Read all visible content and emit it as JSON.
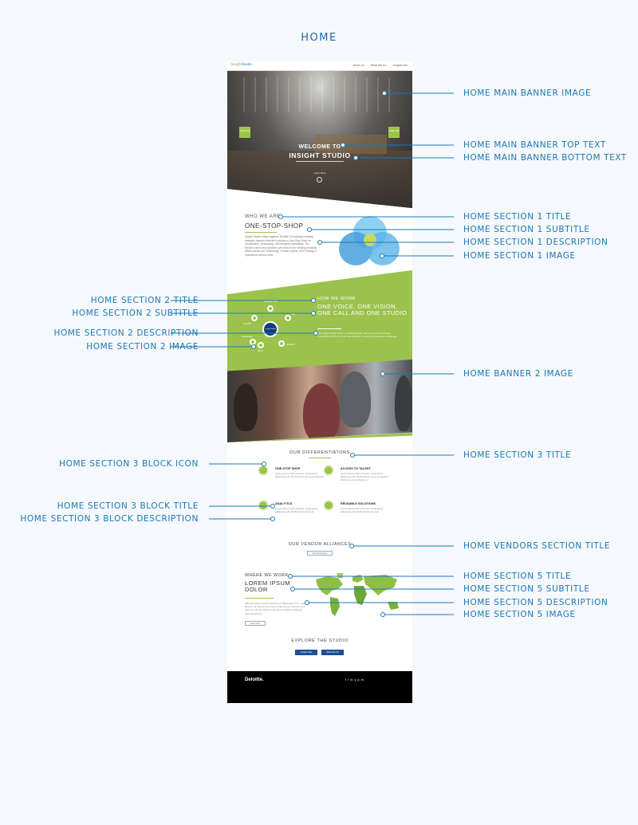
{
  "page_heading": "HOME",
  "nav": {
    "logo_a": "Insight",
    "logo_b": "Studio",
    "links": [
      "About Us",
      "What We Do",
      "Insights Bar"
    ]
  },
  "banner": {
    "tag_left": "Insights Bar",
    "tag_right": "Insights Bar",
    "top_text": "WELCOME TO",
    "bottom_text": "INSIGHT STUDIO",
    "learn": "Learn More"
  },
  "section1": {
    "title": "WHO WE ARE",
    "subtitle": "ONE-STOP-SHOP",
    "description": "Insight Studio brings together Deloitte Consulting's leading analytics domain experts to provide a One-Stop-Shop for visualization, prototyping, and analytics specialists. The Studio's talent and solutions are drawn from existing Analytics efforts across our Technology, Human Capital, and Strategy & Operations service lines."
  },
  "section2": {
    "title": "HOW WE WORK",
    "subtitle": "ONE VOICE, ONE VISION, ONE CALL AND ONE STUDIO",
    "description": "The Insight Studio forms a multidisciplinary team from across Deloitte Consulting with deep and broad expertise to tackle any analytics challenge.",
    "hub": "Insight Studio",
    "nodes": [
      "Business Need",
      "Analytics",
      "Data",
      "Visualization",
      "Talent",
      "Solutions"
    ]
  },
  "section3": {
    "title": "OUR DIFFERENTIATORS",
    "blocks": [
      {
        "title": "ONE-STOP SHOP",
        "desc": "Lorem ipsum dolor sit amet, consectetur adipiscing elit. Morbi lacinia nisi sed maximus."
      },
      {
        "title": "ACCESS TO TALENT",
        "desc": "Lorem ipsum dolor sit amet, consectetur adipiscing elit. Morbi lacinia nisi sed maximus tincidunt, est ut aliquet est."
      },
      {
        "title": "ANALYTICS",
        "desc": "Lorem ipsum dolor sit amet, consectetur adipiscing elit. Morbi lacinia nisi sed."
      },
      {
        "title": "REUSABLE SOLUTIONS",
        "desc": "Lorem ipsum dolor sit amet, consectetur adipiscing elit. Morbi lacinia nisi sed."
      }
    ]
  },
  "vendors": {
    "title": "OUR VENDOR ALLIANCES",
    "button": "View All Vendors"
  },
  "section5": {
    "title": "WHERE WE WORK",
    "subtitle": "LOREM IPSUM DOLOR",
    "description": "With permanent studio locations in Washington D.C. and Boston, as well as Lime Teams that can go wherever you need us, we can deliver data-driven insights anywhere and everywhere.",
    "button": "Learn More"
  },
  "explore": {
    "title": "EXPLORE THE STUDIO",
    "buttons": [
      "Insights Bar",
      "What We Do"
    ]
  },
  "footer": {
    "logo": "Deloitte.",
    "social": [
      "t",
      "f",
      "in",
      "y",
      "p",
      "m"
    ]
  },
  "annotations": {
    "main_banner_image": "HOME MAIN BANNER IMAGE",
    "main_banner_top_text": "HOME MAIN BANNER TOP TEXT",
    "main_banner_bottom_text": "HOME MAIN BANNER BOTTOM TEXT",
    "s1_title": "HOME SECTION 1 TITLE",
    "s1_subtitle": "HOME SECTION 1 SUBTITLE",
    "s1_description": "HOME SECTION 1 DESCRIPTION",
    "s1_image": "HOME SECTION 1 IMAGE",
    "s2_title": "HOME SECTION 2 TITLE",
    "s2_subtitle": "HOME SECTION 2 SUBTITLE",
    "s2_description": "HOME SECTION 2 DESCRIPTION",
    "s2_image": "HOME SECTION 2 IMAGE",
    "banner2_image": "HOME BANNER 2 IMAGE",
    "s3_title": "HOME SECTION 3 TITLE",
    "s3_block_icon": "HOME SECTION 3 BLOCK ICON",
    "s3_block_title": "HOME SECTION 3 BLOCK TITLE",
    "s3_block_description": "HOME SECTION 3 BLOCK DESCRIPTION",
    "vendors_title": "HOME VENDORS SECTION TITLE",
    "s5_title": "HOME SECTION 5 TITLE",
    "s5_subtitle": "HOME SECTION 5 SUBTITLE",
    "s5_description": "HOME SECTION 5 DESCRIPTION",
    "s5_image": "HOME SECTION 5 IMAGE"
  },
  "colors": {
    "annotation": "#1b78b8",
    "green": "#9bc24c",
    "navy": "#123e78",
    "button_blue": "#1b4f95"
  }
}
